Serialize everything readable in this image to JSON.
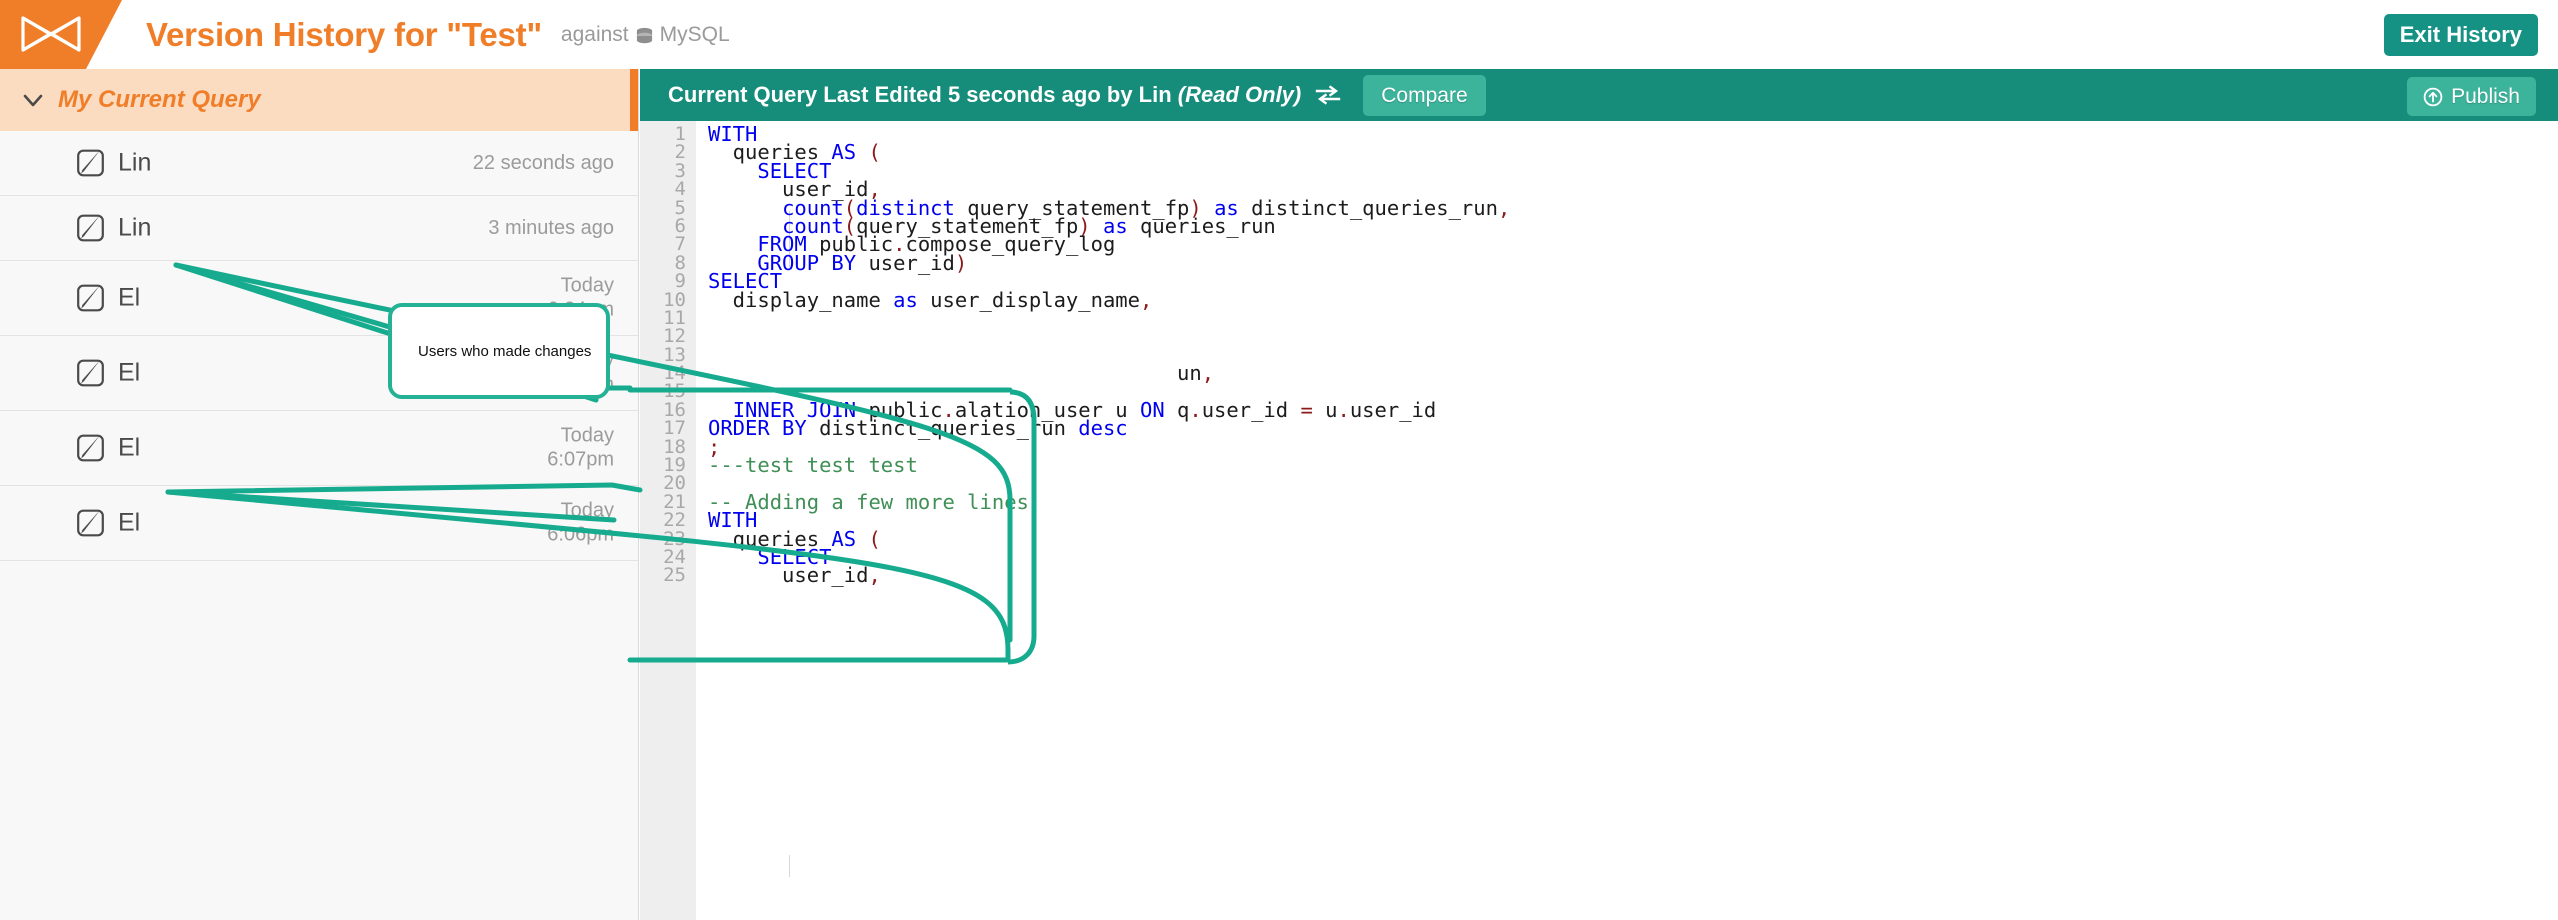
{
  "header": {
    "logo_icon": "alation-bowtie-logo",
    "title": "Version History for \"Test\"",
    "against_label": "against",
    "db_icon": "database-cylinder-icon",
    "db_name": "MySQL",
    "exit_button": "Exit History"
  },
  "sidebar": {
    "section_header": "My Current Query",
    "collapse_icon": "chevron-down-icon",
    "rows": [
      {
        "edit_icon": "edit-pencil-icon",
        "name": "Lin",
        "time": "22 seconds ago"
      },
      {
        "edit_icon": "edit-pencil-icon",
        "name": "Lin",
        "time": "3 minutes ago"
      },
      {
        "edit_icon": "edit-pencil-icon",
        "name": "El",
        "time": "Today\n6:24pm"
      },
      {
        "edit_icon": "edit-pencil-icon",
        "name": "El",
        "time": "Today\n6:11pm"
      },
      {
        "edit_icon": "edit-pencil-icon",
        "name": "El",
        "time": "Today\n6:07pm"
      },
      {
        "edit_icon": "edit-pencil-icon",
        "name": "El",
        "time": "Today\n6:06pm"
      }
    ]
  },
  "query_bar": {
    "status_main": "Current Query Last Edited 5 seconds ago by Lin ",
    "status_readonly": "(Read Only)",
    "swap_icon": "swap-arrows-icon",
    "compare_button": "Compare",
    "publish_button": "Publish",
    "publish_icon": "circle-up-arrow-icon"
  },
  "editor": {
    "lines": [
      {
        "n": 1,
        "parts": [
          {
            "t": "WITH",
            "c": "kw"
          }
        ]
      },
      {
        "n": 2,
        "parts": [
          {
            "t": "  queries ",
            "c": ""
          },
          {
            "t": "AS",
            "c": "kw"
          },
          {
            "t": " ",
            "c": ""
          },
          {
            "t": "(",
            "c": "pn"
          }
        ]
      },
      {
        "n": 3,
        "parts": [
          {
            "t": "    ",
            "c": ""
          },
          {
            "t": "SELECT",
            "c": "kw"
          }
        ]
      },
      {
        "n": 4,
        "parts": [
          {
            "t": "      user_id",
            "c": ""
          },
          {
            "t": ",",
            "c": "pn"
          }
        ]
      },
      {
        "n": 5,
        "parts": [
          {
            "t": "      ",
            "c": ""
          },
          {
            "t": "count",
            "c": "kw"
          },
          {
            "t": "(",
            "c": "pn"
          },
          {
            "t": "distinct",
            "c": "kw"
          },
          {
            "t": " query_statement_fp",
            "c": ""
          },
          {
            "t": ")",
            "c": "pn"
          },
          {
            "t": " ",
            "c": ""
          },
          {
            "t": "as",
            "c": "kw"
          },
          {
            "t": " distinct_queries_run",
            "c": ""
          },
          {
            "t": ",",
            "c": "pn"
          }
        ]
      },
      {
        "n": 6,
        "parts": [
          {
            "t": "      ",
            "c": ""
          },
          {
            "t": "count",
            "c": "kw"
          },
          {
            "t": "(",
            "c": "pn"
          },
          {
            "t": "query_statement_fp",
            "c": ""
          },
          {
            "t": ")",
            "c": "pn"
          },
          {
            "t": " ",
            "c": ""
          },
          {
            "t": "as",
            "c": "kw"
          },
          {
            "t": " queries_run",
            "c": ""
          }
        ]
      },
      {
        "n": 7,
        "parts": [
          {
            "t": "    ",
            "c": ""
          },
          {
            "t": "FROM",
            "c": "kw"
          },
          {
            "t": " public",
            "c": ""
          },
          {
            "t": ".",
            "c": "pn"
          },
          {
            "t": "compose_query_log",
            "c": ""
          }
        ]
      },
      {
        "n": 8,
        "parts": [
          {
            "t": "    ",
            "c": ""
          },
          {
            "t": "GROUP BY",
            "c": "kw"
          },
          {
            "t": " user_id",
            "c": ""
          },
          {
            "t": ")",
            "c": "pn"
          }
        ]
      },
      {
        "n": 9,
        "parts": [
          {
            "t": "SELECT",
            "c": "kw"
          }
        ]
      },
      {
        "n": 10,
        "parts": [
          {
            "t": "  display_name ",
            "c": ""
          },
          {
            "t": "as",
            "c": "kw"
          },
          {
            "t": " user_display_name",
            "c": ""
          },
          {
            "t": ",",
            "c": "pn"
          }
        ]
      },
      {
        "n": 11,
        "parts": [
          {
            "t": "",
            "c": ""
          }
        ]
      },
      {
        "n": 12,
        "parts": [
          {
            "t": "",
            "c": ""
          }
        ]
      },
      {
        "n": 13,
        "parts": [
          {
            "t": "",
            "c": ""
          }
        ]
      },
      {
        "n": 14,
        "parts": [
          {
            "t": "                                      un",
            "c": ""
          },
          {
            "t": ",",
            "c": "pn"
          }
        ]
      },
      {
        "n": 15,
        "parts": [
          {
            "t": "",
            "c": ""
          }
        ]
      },
      {
        "n": 16,
        "parts": [
          {
            "t": "  ",
            "c": ""
          },
          {
            "t": "INNER JOIN",
            "c": "kw"
          },
          {
            "t": " public",
            "c": ""
          },
          {
            "t": ".",
            "c": "pn"
          },
          {
            "t": "alation_user u ",
            "c": ""
          },
          {
            "t": "ON",
            "c": "kw"
          },
          {
            "t": " q",
            "c": ""
          },
          {
            "t": ".",
            "c": "pn"
          },
          {
            "t": "user_id ",
            "c": ""
          },
          {
            "t": "=",
            "c": "pn"
          },
          {
            "t": " u",
            "c": ""
          },
          {
            "t": ".",
            "c": "pn"
          },
          {
            "t": "user_id",
            "c": ""
          }
        ]
      },
      {
        "n": 17,
        "parts": [
          {
            "t": "ORDER BY",
            "c": "kw"
          },
          {
            "t": " distinct_queries_run ",
            "c": ""
          },
          {
            "t": "desc",
            "c": "kw"
          }
        ]
      },
      {
        "n": 18,
        "parts": [
          {
            "t": ";",
            "c": "pn"
          }
        ]
      },
      {
        "n": 19,
        "parts": [
          {
            "t": "---test test test",
            "c": "cm"
          }
        ]
      },
      {
        "n": 20,
        "parts": [
          {
            "t": "",
            "c": ""
          }
        ]
      },
      {
        "n": 21,
        "parts": [
          {
            "t": "-- Adding a few more lines",
            "c": "cm"
          }
        ]
      },
      {
        "n": 22,
        "parts": [
          {
            "t": "WITH",
            "c": "kw"
          }
        ]
      },
      {
        "n": 23,
        "parts": [
          {
            "t": "  queries ",
            "c": ""
          },
          {
            "t": "AS",
            "c": "kw"
          },
          {
            "t": " ",
            "c": ""
          },
          {
            "t": "(",
            "c": "pn"
          }
        ]
      },
      {
        "n": 24,
        "parts": [
          {
            "t": "    ",
            "c": ""
          },
          {
            "t": "SELECT",
            "c": "kw"
          }
        ]
      },
      {
        "n": 25,
        "parts": [
          {
            "t": "      user_id",
            "c": ""
          },
          {
            "t": ",",
            "c": "pn"
          }
        ]
      }
    ]
  },
  "annotation": {
    "callout_text": "Users who made changes",
    "color": "#25b196"
  }
}
